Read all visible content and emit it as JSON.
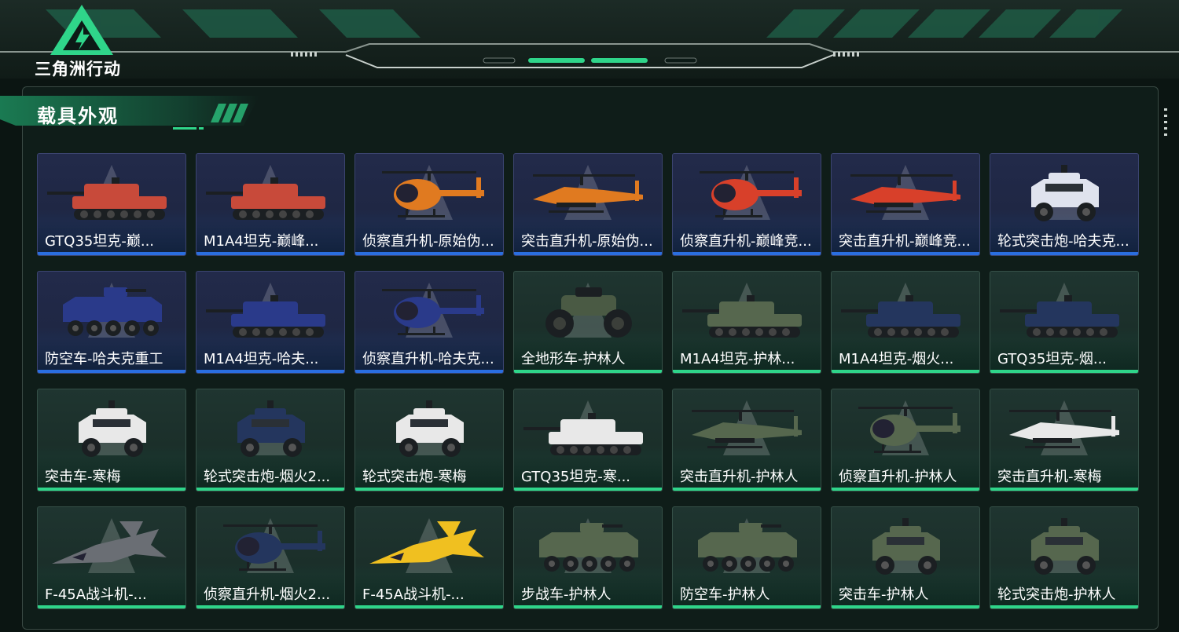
{
  "app": {
    "logo_text": "三角洲行动",
    "section_title": "载具外观"
  },
  "colors": {
    "accent_green": "#2fd58a",
    "accent_blue": "#2a6ee0",
    "background": "#0b1512"
  },
  "cards": [
    {
      "label": "GTQ35坦克-巅...",
      "tier": "blue",
      "icon": "tank-icon",
      "tint": "#c84a3a"
    },
    {
      "label": "M1A4坦克-巅峰...",
      "tier": "blue",
      "icon": "tank-icon",
      "tint": "#c84a3a"
    },
    {
      "label": "侦察直升机-原始伪...",
      "tier": "blue",
      "icon": "scout-helicopter-icon",
      "tint": "#e07a20"
    },
    {
      "label": "突击直升机-原始伪...",
      "tier": "blue",
      "icon": "attack-helicopter-icon",
      "tint": "#e07a20"
    },
    {
      "label": "侦察直升机-巅峰竞...",
      "tier": "blue",
      "icon": "scout-helicopter-icon",
      "tint": "#d8402a"
    },
    {
      "label": "突击直升机-巅峰竞...",
      "tier": "blue",
      "icon": "attack-helicopter-icon",
      "tint": "#d8402a"
    },
    {
      "label": "轮式突击炮-哈夫克...",
      "tier": "blue",
      "icon": "armored-car-icon",
      "tint": "#dfe3ee"
    },
    {
      "label": "防空车-哈夫克重工",
      "tier": "blue",
      "icon": "apc-icon",
      "tint": "#2a3a8a"
    },
    {
      "label": "M1A4坦克-哈夫...",
      "tier": "blue",
      "icon": "tank-icon",
      "tint": "#2a3a8a"
    },
    {
      "label": "侦察直升机-哈夫克...",
      "tier": "blue",
      "icon": "scout-helicopter-icon",
      "tint": "#2a3a8a"
    },
    {
      "label": "全地形车-护林人",
      "tier": "green",
      "icon": "atv-icon",
      "tint": "#4a5a44"
    },
    {
      "label": "M1A4坦克-护林...",
      "tier": "green",
      "icon": "tank-icon",
      "tint": "#56674e"
    },
    {
      "label": "M1A4坦克-烟火...",
      "tier": "green",
      "icon": "tank-icon",
      "tint": "#24365e"
    },
    {
      "label": "GTQ35坦克-烟...",
      "tier": "green",
      "icon": "tank-icon",
      "tint": "#24365e"
    },
    {
      "label": "突击车-寒梅",
      "tier": "green",
      "icon": "assault-vehicle-icon",
      "tint": "#e8e8e8"
    },
    {
      "label": "轮式突击炮-烟火2...",
      "tier": "green",
      "icon": "armored-car-icon",
      "tint": "#24365e"
    },
    {
      "label": "轮式突击炮-寒梅",
      "tier": "green",
      "icon": "armored-car-icon",
      "tint": "#e8e8e8"
    },
    {
      "label": "GTQ35坦克-寒...",
      "tier": "green",
      "icon": "tank-icon",
      "tint": "#e8e8e8"
    },
    {
      "label": "突击直升机-护林人",
      "tier": "green",
      "icon": "attack-helicopter-icon",
      "tint": "#56674e"
    },
    {
      "label": "侦察直升机-护林人",
      "tier": "green",
      "icon": "scout-helicopter-icon",
      "tint": "#56674e"
    },
    {
      "label": "突击直升机-寒梅",
      "tier": "green",
      "icon": "attack-helicopter-icon",
      "tint": "#e8e8e8"
    },
    {
      "label": "F-45A战斗机-...",
      "tier": "green",
      "icon": "fighter-jet-icon",
      "tint": "#6a6e74"
    },
    {
      "label": "侦察直升机-烟火2...",
      "tier": "green",
      "icon": "scout-helicopter-icon",
      "tint": "#24365e"
    },
    {
      "label": "F-45A战斗机-...",
      "tier": "green",
      "icon": "fighter-jet-icon",
      "tint": "#f0c020"
    },
    {
      "label": "步战车-护林人",
      "tier": "green",
      "icon": "apc-icon",
      "tint": "#56674e"
    },
    {
      "label": "防空车-护林人",
      "tier": "green",
      "icon": "apc-icon",
      "tint": "#56674e"
    },
    {
      "label": "突击车-护林人",
      "tier": "green",
      "icon": "assault-vehicle-icon",
      "tint": "#56674e"
    },
    {
      "label": "轮式突击炮-护林人",
      "tier": "green",
      "icon": "armored-car-icon",
      "tint": "#56674e"
    }
  ]
}
